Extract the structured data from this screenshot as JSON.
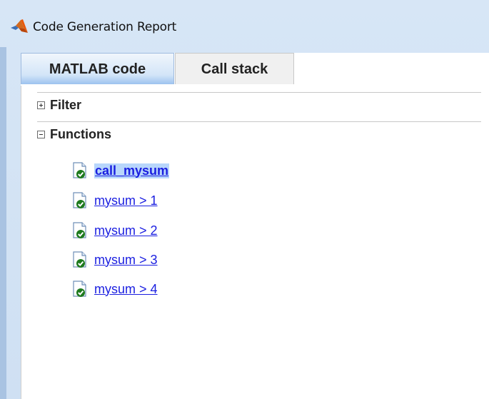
{
  "window": {
    "title": "Code Generation Report",
    "app_icon": "matlab-logo-icon"
  },
  "tabs": [
    {
      "label": "MATLAB code",
      "active": true
    },
    {
      "label": "Call stack",
      "active": false
    }
  ],
  "sections": {
    "filter": {
      "label": "Filter",
      "expanded": false,
      "toggle_icon": "expand-plus-icon"
    },
    "functions": {
      "label": "Functions",
      "expanded": true,
      "toggle_icon": "collapse-minus-icon"
    }
  },
  "functions": [
    {
      "label": "call_mysum",
      "selected": true,
      "icon": "file-check-icon"
    },
    {
      "label": "mysum > 1",
      "selected": false,
      "icon": "file-check-icon"
    },
    {
      "label": "mysum > 2",
      "selected": false,
      "icon": "file-check-icon"
    },
    {
      "label": "mysum > 3",
      "selected": false,
      "icon": "file-check-icon"
    },
    {
      "label": "mysum > 4",
      "selected": false,
      "icon": "file-check-icon"
    }
  ],
  "colors": {
    "link": "#1a1ee0",
    "selection": "#b8d6fb",
    "check_green": "#1e7a1e",
    "titlebar": "#d7e6f6"
  }
}
